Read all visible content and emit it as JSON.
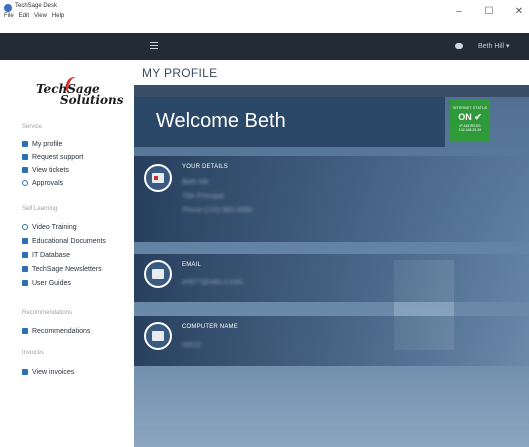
{
  "window": {
    "title": "TechSage Desk",
    "menu": [
      "File",
      "Edit",
      "View",
      "Help"
    ],
    "controls": [
      "–",
      "☐",
      "✕"
    ]
  },
  "topbar": {
    "user_menu": "Beth Hill ▾"
  },
  "logo": {
    "line1": "TechSage",
    "line2": "Solutions"
  },
  "sidebar": {
    "sections": [
      {
        "label": "Service",
        "items": [
          {
            "label": "My profile",
            "icon": "user-icon"
          },
          {
            "label": "Request support",
            "icon": "tag-icon"
          },
          {
            "label": "View tickets",
            "icon": "tickets-icon"
          },
          {
            "label": "Approvals",
            "icon": "thumbs-up-icon"
          }
        ]
      },
      {
        "label": "Self Learning",
        "items": [
          {
            "label": "Video Training",
            "icon": "lightbulb-icon"
          },
          {
            "label": "Educational Documents",
            "icon": "book-icon"
          },
          {
            "label": "IT Database",
            "icon": "database-icon"
          },
          {
            "label": "TechSage Newsletters",
            "icon": "newsletter-icon"
          },
          {
            "label": "User Guides",
            "icon": "guide-icon"
          }
        ]
      },
      {
        "label": "Recommendations",
        "items": [
          {
            "label": "Recommendations",
            "icon": "recommendations-icon"
          }
        ]
      },
      {
        "label": "Invoices",
        "items": [
          {
            "label": "View invoices",
            "icon": "invoice-icon"
          }
        ]
      }
    ]
  },
  "main": {
    "page_title": "MY PROFILE",
    "welcome": "Welcome Beth",
    "status": {
      "label": "INTERNET STATUS",
      "value": "ON ✔",
      "ip_label": "IP ADDRESS",
      "ip": "192.168.25.39",
      "color": "#2f9a3a"
    },
    "details": {
      "title": "YOUR DETAILS",
      "name": "Beth Hill",
      "role": "Title Principal",
      "phone": "Phone (210) 863-3060"
    },
    "email": {
      "title": "EMAIL",
      "value": "eh877@sats.rr.com"
    },
    "computer": {
      "title": "COMPUTER NAME",
      "value": "NIK12"
    }
  },
  "colors": {
    "topbar": "#232b36",
    "welcome_bar": "#2c4868",
    "accent": "#2d6fb4"
  }
}
